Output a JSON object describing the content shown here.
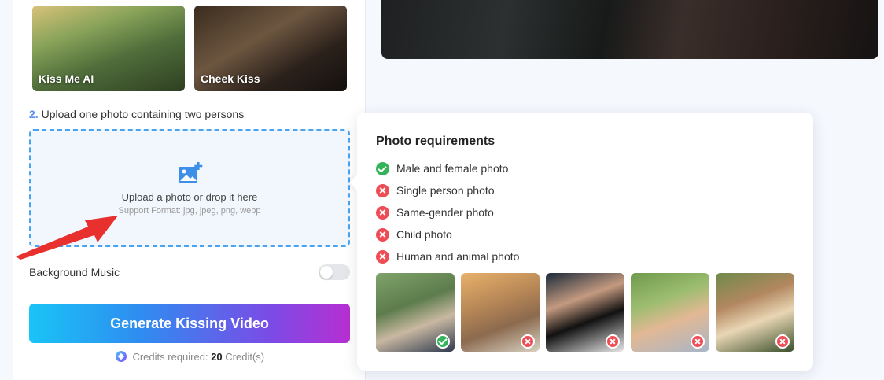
{
  "styles": [
    {
      "label": "Kiss Me AI"
    },
    {
      "label": "Cheek Kiss"
    }
  ],
  "upload_step": {
    "number": "2.",
    "text": "Upload one photo containing two persons"
  },
  "upload_box": {
    "main_text": "Upload a photo or drop it here",
    "sub_text": "Support Format: jpg, jpeg, png, webp"
  },
  "music": {
    "label": "Background Music",
    "enabled": false
  },
  "generate_button": {
    "label": "Generate Kissing Video"
  },
  "credits": {
    "prefix": "Credits required:",
    "amount": "20",
    "unit": "Credit(s)"
  },
  "requirements": {
    "title": "Photo requirements",
    "items": [
      {
        "text": "Male and female photo",
        "status": "ok"
      },
      {
        "text": "Single person photo",
        "status": "no"
      },
      {
        "text": "Same-gender photo",
        "status": "no"
      },
      {
        "text": "Child photo",
        "status": "no"
      },
      {
        "text": "Human and animal photo",
        "status": "no"
      }
    ],
    "samples": [
      "ok",
      "no",
      "no",
      "no",
      "no"
    ]
  },
  "colors": {
    "accent_blue": "#4aa3ee",
    "ok_green": "#34b35a",
    "no_red": "#ef4d55",
    "arrow_red": "#e8312f"
  }
}
